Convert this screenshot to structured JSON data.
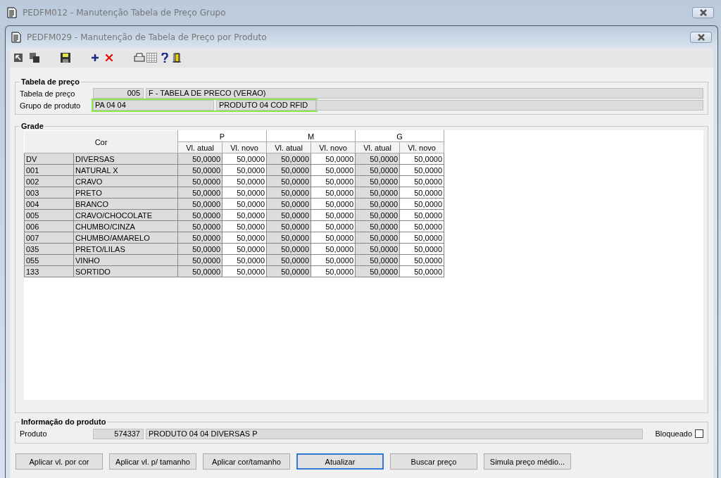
{
  "outer_window": {
    "title": "PEDFM012 - Manutenção Tabela de Preço Grupo"
  },
  "window": {
    "title": "PEDFM029 - Manutenção de Tabela de Preço por Produto"
  },
  "price_table_group": {
    "title": "Tabela de preço",
    "fields": [
      {
        "label": "Tabela de preço",
        "code": "005",
        "description": "F - TABELA DE PRECO (VERAO)",
        "highlighted": false
      },
      {
        "label": "Grupo de produto",
        "code": "PA 04 04",
        "description": "PRODUTO 04 COD RFID",
        "highlighted": true
      }
    ]
  },
  "grid": {
    "title": "Grade",
    "first_header": "Cor",
    "sizes": [
      {
        "label": "P",
        "subheaders": [
          "Vl. atual",
          "Vl. novo"
        ]
      },
      {
        "label": "M",
        "subheaders": [
          "Vl. atual",
          "Vl. novo"
        ]
      },
      {
        "label": "G",
        "subheaders": [
          "Vl. atual",
          "Vl. novo"
        ]
      }
    ],
    "rows": [
      {
        "code": "DV",
        "name": "DIVERSAS",
        "values": [
          "50,0000",
          "50,0000",
          "50,0000",
          "50,0000",
          "50,0000",
          "50,0000"
        ]
      },
      {
        "code": "001",
        "name": "NATURAL X",
        "values": [
          "50,0000",
          "50,0000",
          "50,0000",
          "50,0000",
          "50,0000",
          "50,0000"
        ]
      },
      {
        "code": "002",
        "name": "CRAVO",
        "values": [
          "50,0000",
          "50,0000",
          "50,0000",
          "50,0000",
          "50,0000",
          "50,0000"
        ]
      },
      {
        "code": "003",
        "name": "PRETO",
        "values": [
          "50,0000",
          "50,0000",
          "50,0000",
          "50,0000",
          "50,0000",
          "50,0000"
        ]
      },
      {
        "code": "004",
        "name": "BRANCO",
        "values": [
          "50,0000",
          "50,0000",
          "50,0000",
          "50,0000",
          "50,0000",
          "50,0000"
        ]
      },
      {
        "code": "005",
        "name": "CRAVO/CHOCOLATE",
        "values": [
          "50,0000",
          "50,0000",
          "50,0000",
          "50,0000",
          "50,0000",
          "50,0000"
        ]
      },
      {
        "code": "006",
        "name": "CHUMBO/CINZA",
        "values": [
          "50,0000",
          "50,0000",
          "50,0000",
          "50,0000",
          "50,0000",
          "50,0000"
        ]
      },
      {
        "code": "007",
        "name": "CHUMBO/AMARELO",
        "values": [
          "50,0000",
          "50,0000",
          "50,0000",
          "50,0000",
          "50,0000",
          "50,0000"
        ]
      },
      {
        "code": "035",
        "name": "PRETO/LILAS",
        "values": [
          "50,0000",
          "50,0000",
          "50,0000",
          "50,0000",
          "50,0000",
          "50,0000"
        ]
      },
      {
        "code": "055",
        "name": "VINHO",
        "values": [
          "50,0000",
          "50,0000",
          "50,0000",
          "50,0000",
          "50,0000",
          "50,0000"
        ]
      },
      {
        "code": "133",
        "name": "SORTIDO",
        "values": [
          "50,0000",
          "50,0000",
          "50,0000",
          "50,0000",
          "50,0000",
          "50,0000"
        ]
      }
    ]
  },
  "product_info": {
    "title": "Informação do produto",
    "label": "Produto",
    "code": "574337",
    "description": "PRODUTO 04 04 DIVERSAS P",
    "blocked_label": "Bloqueado",
    "blocked": false
  },
  "buttons": [
    {
      "label": "Aplicar vl. por cor",
      "focused": false
    },
    {
      "label": "Aplicar vl. p/ tamanho",
      "focused": false
    },
    {
      "label": "Aplicar cor/tamanho",
      "focused": false
    },
    {
      "label": "Atualizar",
      "focused": true
    },
    {
      "label": "Buscar preço",
      "focused": false
    },
    {
      "label": "Simula preço médio...",
      "focused": false
    }
  ]
}
